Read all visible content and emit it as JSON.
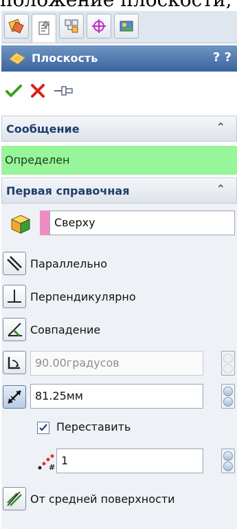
{
  "top_caption": "положение плоскости, введите значений",
  "panel": {
    "title": "Плоскость",
    "help": "? ?"
  },
  "message_section": {
    "header": "Сообщение",
    "collapse": "⌃",
    "text": "Определен"
  },
  "first_reference": {
    "header": "Первая справочная",
    "collapse": "⌃",
    "selection": "Сверху",
    "options": {
      "parallel": "Параллельно",
      "perpendicular": "Перпендикулярно",
      "coincident": "Совпадение"
    },
    "angle_value": "90.00градусов",
    "distance_value": "81.25мм",
    "flip_label": "Переставить",
    "flip_checked": true,
    "instances_value": "1",
    "midplane_label": "От средней поверхности"
  },
  "colors": {
    "message_bg": "#97f59a",
    "title_bg": "#3b64a0",
    "selection_swatch": "#f08cc4"
  }
}
